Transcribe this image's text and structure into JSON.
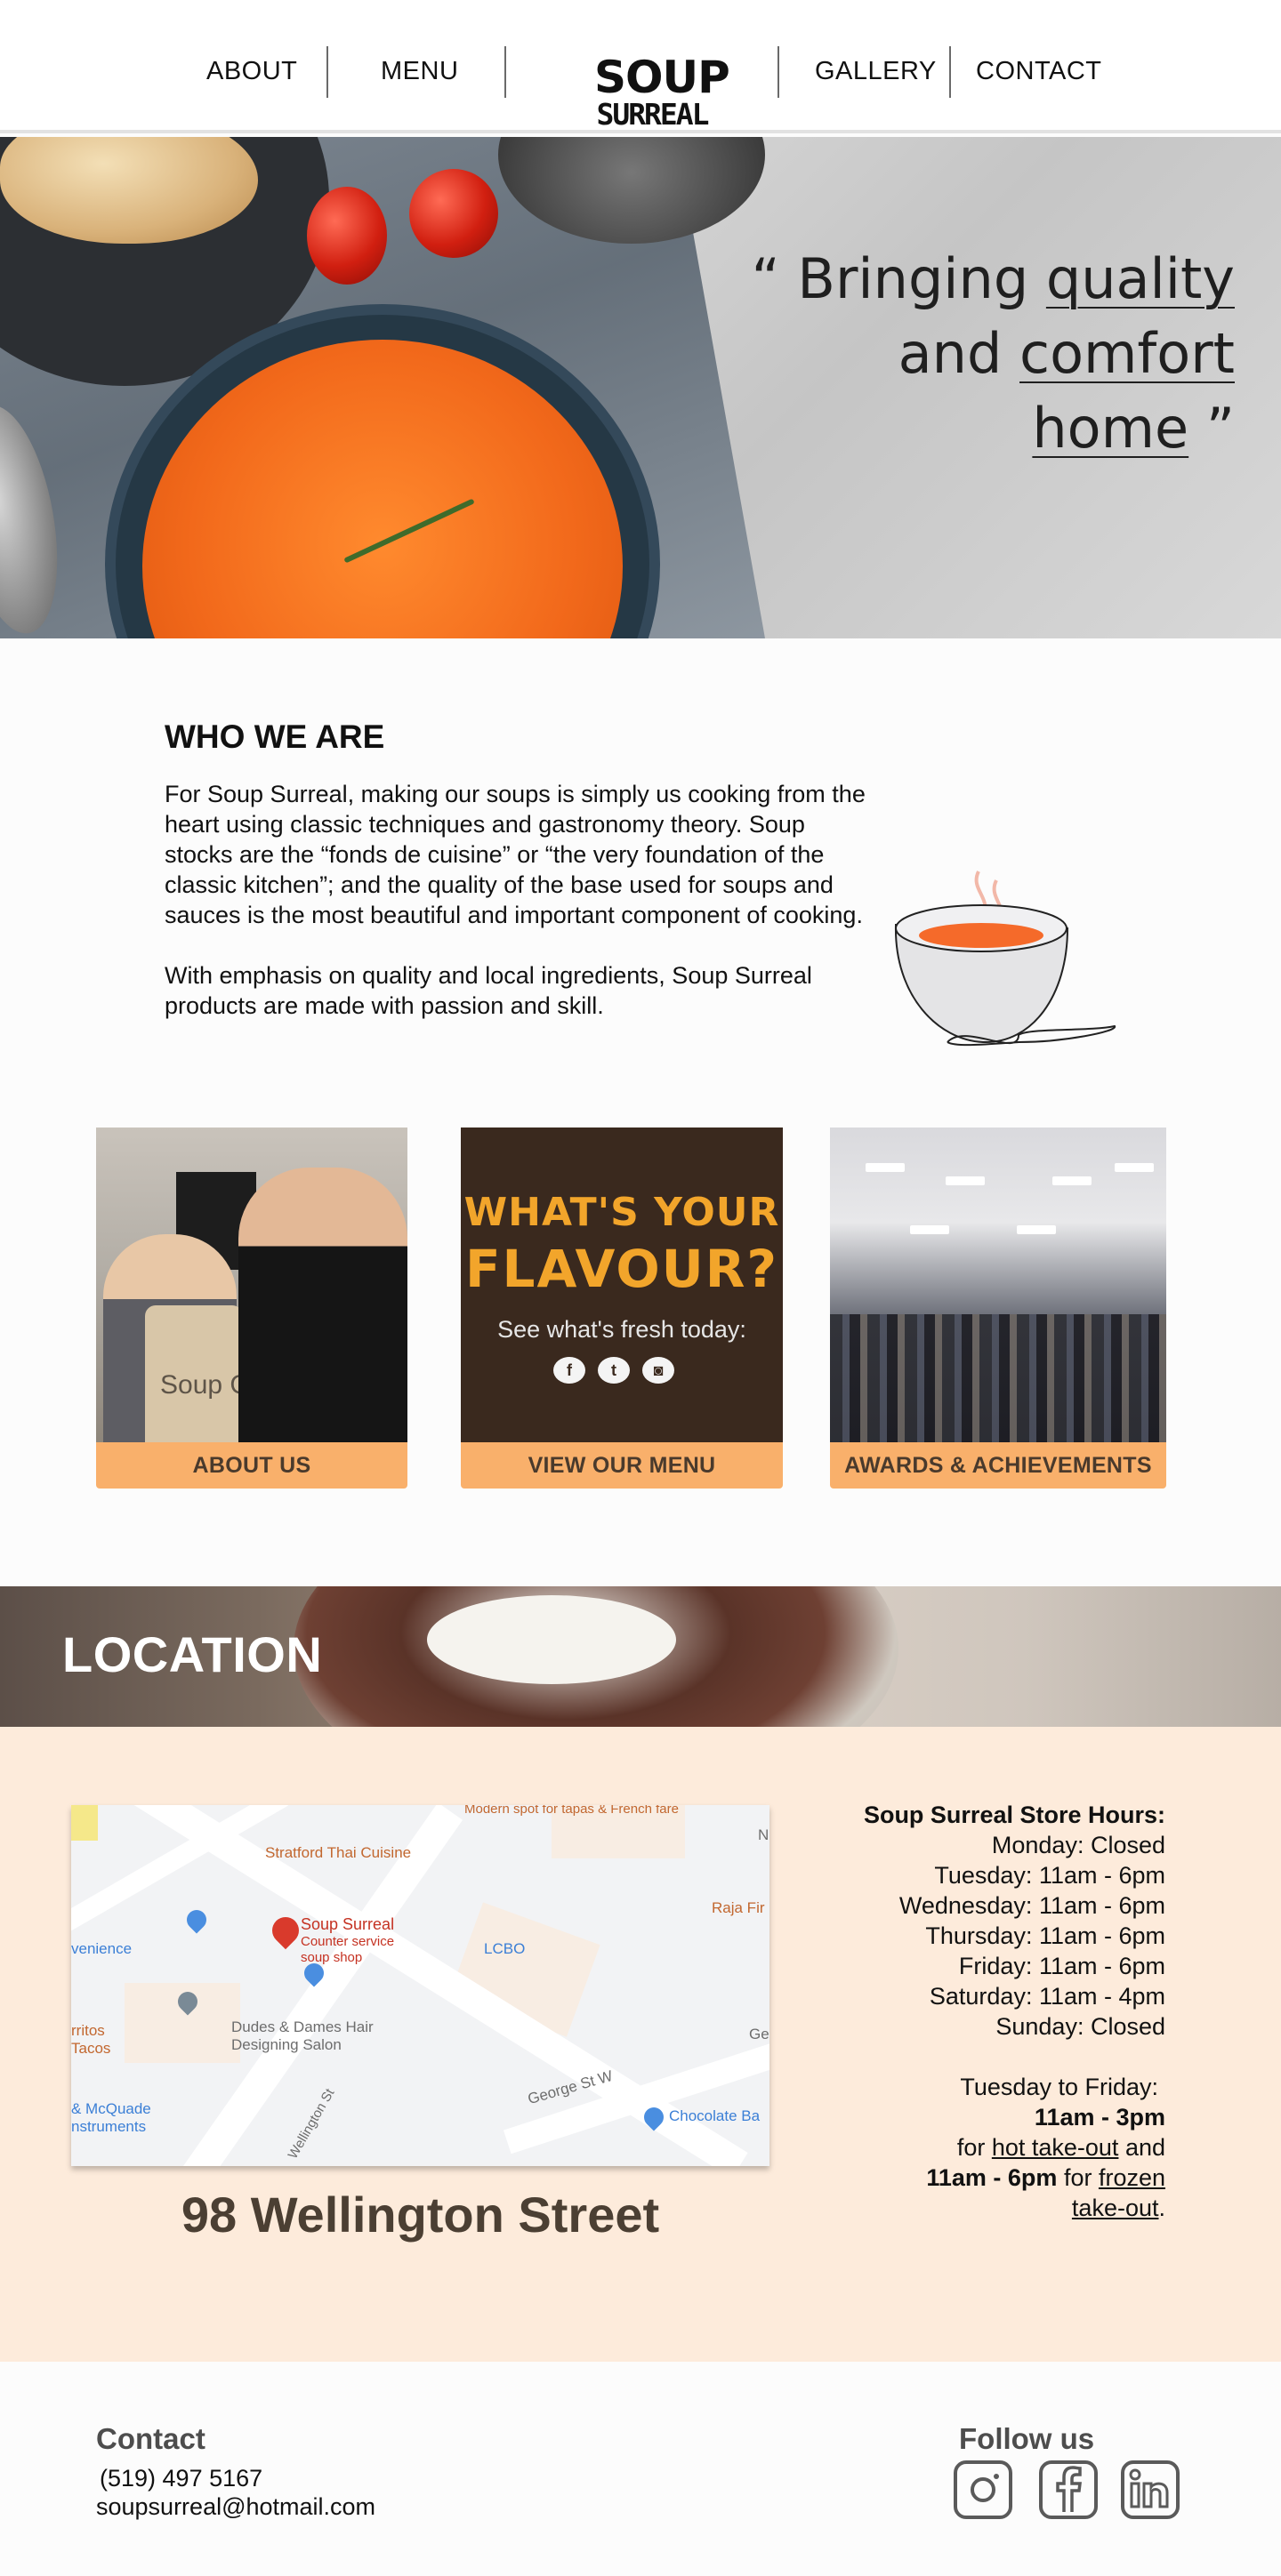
{
  "nav": {
    "about": "ABOUT",
    "menu": "MENU",
    "logo_line1": "SOUP",
    "logo_line2": "SURREAL",
    "gallery": "GALLERY",
    "contact": "CONTACT"
  },
  "hero": {
    "quote_open": "“ Bringing ",
    "quote_quality": "quality",
    "quote_and": "and ",
    "quote_comfort": "comfort",
    "quote_home": "home",
    "quote_close": " ”"
  },
  "who": {
    "title": "WHO WE ARE",
    "paragraph1": "For Soup Surreal, making our soups is simply us cooking from the heart using classic techniques and gastronomy theory. Soup stocks are the “fonds de cuisine” or “the very foundation of the classic kitchen”; and the quality of the base used for soups and sauces is the most beautiful and important component of cooking.",
    "paragraph2": "With emphasis on quality and local ingredients, Soup Surreal products are made with passion and skill."
  },
  "cards": [
    {
      "label": "ABOUT US",
      "image_text": "Soup Girl"
    },
    {
      "label": "VIEW OUR MENU",
      "image_line1": "WHAT'S YOUR",
      "image_line2": "FLAVOUR?",
      "image_line3": "See what's fresh today:",
      "social": [
        "f",
        "t",
        "◙"
      ]
    },
    {
      "label": "AWARDS & ACHIEVEMENTS"
    }
  ],
  "location": {
    "title": "LOCATION",
    "address": "98 Wellington Street",
    "map": {
      "labels": [
        "Modern spot for tapas & French fare",
        "Stratford Thai Cuisine",
        "Soup Surreal",
        "Counter service",
        "soup shop",
        "Raja Fir",
        "venience",
        "LCBO",
        "Dudes & Dames Hair",
        "Designing Salon",
        "rritos",
        "Tacos",
        "George St W",
        "Ge",
        "& McQuade",
        "nstruments",
        "Wellington St",
        "Chocolate Ba",
        "N"
      ]
    },
    "hours": {
      "title": "Soup Surreal Store Hours:",
      "days": [
        "Monday: Closed",
        "Tuesday: 11am - 6pm",
        "Wednesday: 11am - 6pm",
        "Thursday: 11am - 6pm",
        "Friday: 11am - 6pm",
        "Saturday: 11am - 4pm",
        "Sunday: Closed"
      ],
      "takeout_intro": "Tuesday to Friday:",
      "takeout_hot_time": "11am - 3pm",
      "takeout_for": "for ",
      "takeout_hot": "hot take-out",
      "takeout_and": " and",
      "takeout_frozen_time": "11am - 6pm",
      "takeout_for2": " for ",
      "takeout_frozen": "frozen",
      "takeout_frozen2": " take-out",
      "takeout_period": "."
    }
  },
  "footer": {
    "contact_title": "Contact",
    "phone": "(519) 497 5167",
    "email": "soupsurreal@hotmail.com",
    "follow_title": "Follow us",
    "social_icons": [
      "instagram-icon",
      "facebook-icon",
      "linkedin-icon"
    ]
  }
}
